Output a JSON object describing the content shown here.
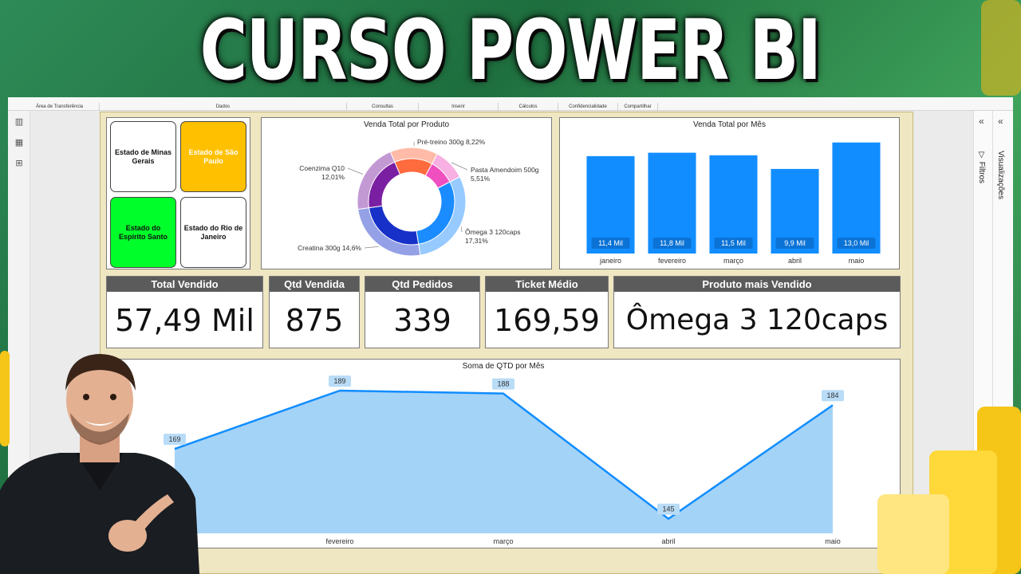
{
  "headline": "CURSO POWER BI",
  "ribbon": {
    "groups": [
      "Área de Transferência",
      "Dados",
      "Consultas",
      "Inserir",
      "Cálculos",
      "Confidencialidade",
      "Compartilhar"
    ]
  },
  "right_panes": {
    "filters_label": "Filtros",
    "visualizations_label": "Visualizações"
  },
  "state_buttons": [
    {
      "label": "Estado de Minas Gerais",
      "color": "#ffffff"
    },
    {
      "label": "Estado de São Paulo",
      "color": "#ffc000"
    },
    {
      "label": "Estado do Espírito Santo",
      "color": "#00ff2a"
    },
    {
      "label": "Estado do Rio de Janeiro",
      "color": "#ffffff"
    }
  ],
  "donut": {
    "title": "Venda Total por Produto",
    "slices": [
      {
        "name": "Pré-treino 300g",
        "label": "Pré-treino 300g 8,22%",
        "pct": 8.22,
        "color": "#ff6b3d"
      },
      {
        "name": "Pasta Amendoim 500g",
        "label": "Pasta Amendoim 500g 5,51%",
        "pct": 5.51,
        "color": "#f04fc0"
      },
      {
        "name": "Ômega 3 120caps",
        "label": "Ômega 3 120caps 17,31%",
        "pct": 17.31,
        "color": "#1a8cff"
      },
      {
        "name": "Creatina 300g",
        "label": "Creatina 300g 14,6%",
        "pct": 14.6,
        "color": "#1730c8"
      },
      {
        "name": "Coenzima Q10",
        "label": "Coenzima Q10 12,01%",
        "pct": 12.01,
        "color": "#7b1fa2"
      }
    ]
  },
  "chart_data": [
    {
      "type": "bar",
      "title": "Venda Total por Mês",
      "categories": [
        "janeiro",
        "fevereiro",
        "março",
        "abril",
        "maio"
      ],
      "values": [
        11.4,
        11.8,
        11.5,
        9.9,
        13.0
      ],
      "data_labels": [
        "11,4 Mil",
        "11,8 Mil",
        "11,5 Mil",
        "9,9 Mil",
        "13,0 Mil"
      ],
      "ylim": [
        0,
        14
      ],
      "color": "#118dff",
      "grid": false
    },
    {
      "type": "area",
      "title": "Soma de QTD por Mês",
      "categories": [
        "janeiro",
        "fevereiro",
        "março",
        "abril",
        "maio"
      ],
      "tick_labels": [
        "",
        "fevereiro",
        "março",
        "abril",
        "maio"
      ],
      "values": [
        169,
        189,
        188,
        145,
        184
      ],
      "data_labels": [
        "169",
        "189",
        "188",
        "145",
        "184"
      ],
      "ylim": [
        140,
        192
      ],
      "color": "#118dff",
      "fill": "#9fd1f8"
    }
  ],
  "kpis": [
    {
      "title": "Total Vendido",
      "value": "57,49 Mil"
    },
    {
      "title": "Qtd Vendida",
      "value": "875"
    },
    {
      "title": "Qtd Pedidos",
      "value": "339"
    },
    {
      "title": "Ticket Médio",
      "value": "169,59"
    },
    {
      "title": "Produto mais Vendido",
      "value": "Ômega 3 120caps"
    }
  ]
}
